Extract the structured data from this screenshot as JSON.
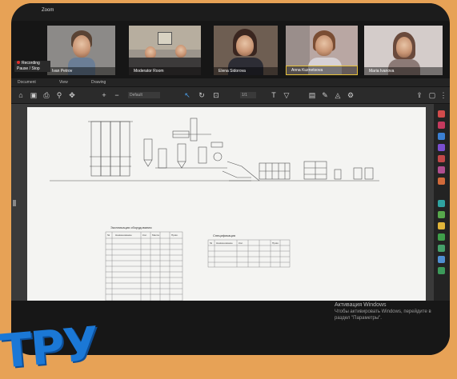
{
  "window": {
    "title": "Zoom"
  },
  "participants": [
    {
      "name": "Ivan Petrov"
    },
    {
      "name": "Moderator Room"
    },
    {
      "name": "Elena Sidorova"
    },
    {
      "name": "Anna Kuznetsova"
    },
    {
      "name": "Maria Ivanova"
    }
  ],
  "recording": {
    "label": "Recording",
    "sub": "Pause / Stop"
  },
  "tabs": [
    "Document",
    "View",
    "Drawing"
  ],
  "toolbar": {
    "zoom_value": "Default",
    "page_value": "1/1",
    "icons": [
      "home-icon",
      "save-icon",
      "print-icon",
      "search-icon",
      "pan-icon",
      "zoom-in-icon",
      "zoom-out-icon",
      "rotate-icon",
      "select-icon",
      "measure-icon",
      "text-icon",
      "pen-icon",
      "highlight-icon",
      "settings-icon",
      "share-icon",
      "more-icon"
    ]
  },
  "drawing": {
    "table_left_title": "Экспликация оборудования",
    "table_right_title": "Спецификация",
    "table_left_headers": [
      "№",
      "Наименование",
      "Кол.",
      "Масса",
      "Прим."
    ],
    "table_right_headers": [
      "№",
      "Наименование",
      "Кол.",
      "Прим."
    ]
  },
  "activation": {
    "line1": "Активация Windows",
    "line2": "Чтобы активировать Windows, перейдите в",
    "line3": "раздел \"Параметры\"."
  },
  "watermark": {
    "text": "ТРУ"
  },
  "colors": {
    "accent": "#1b78d6",
    "background": "#e7a256",
    "recording": "#e0302d"
  }
}
